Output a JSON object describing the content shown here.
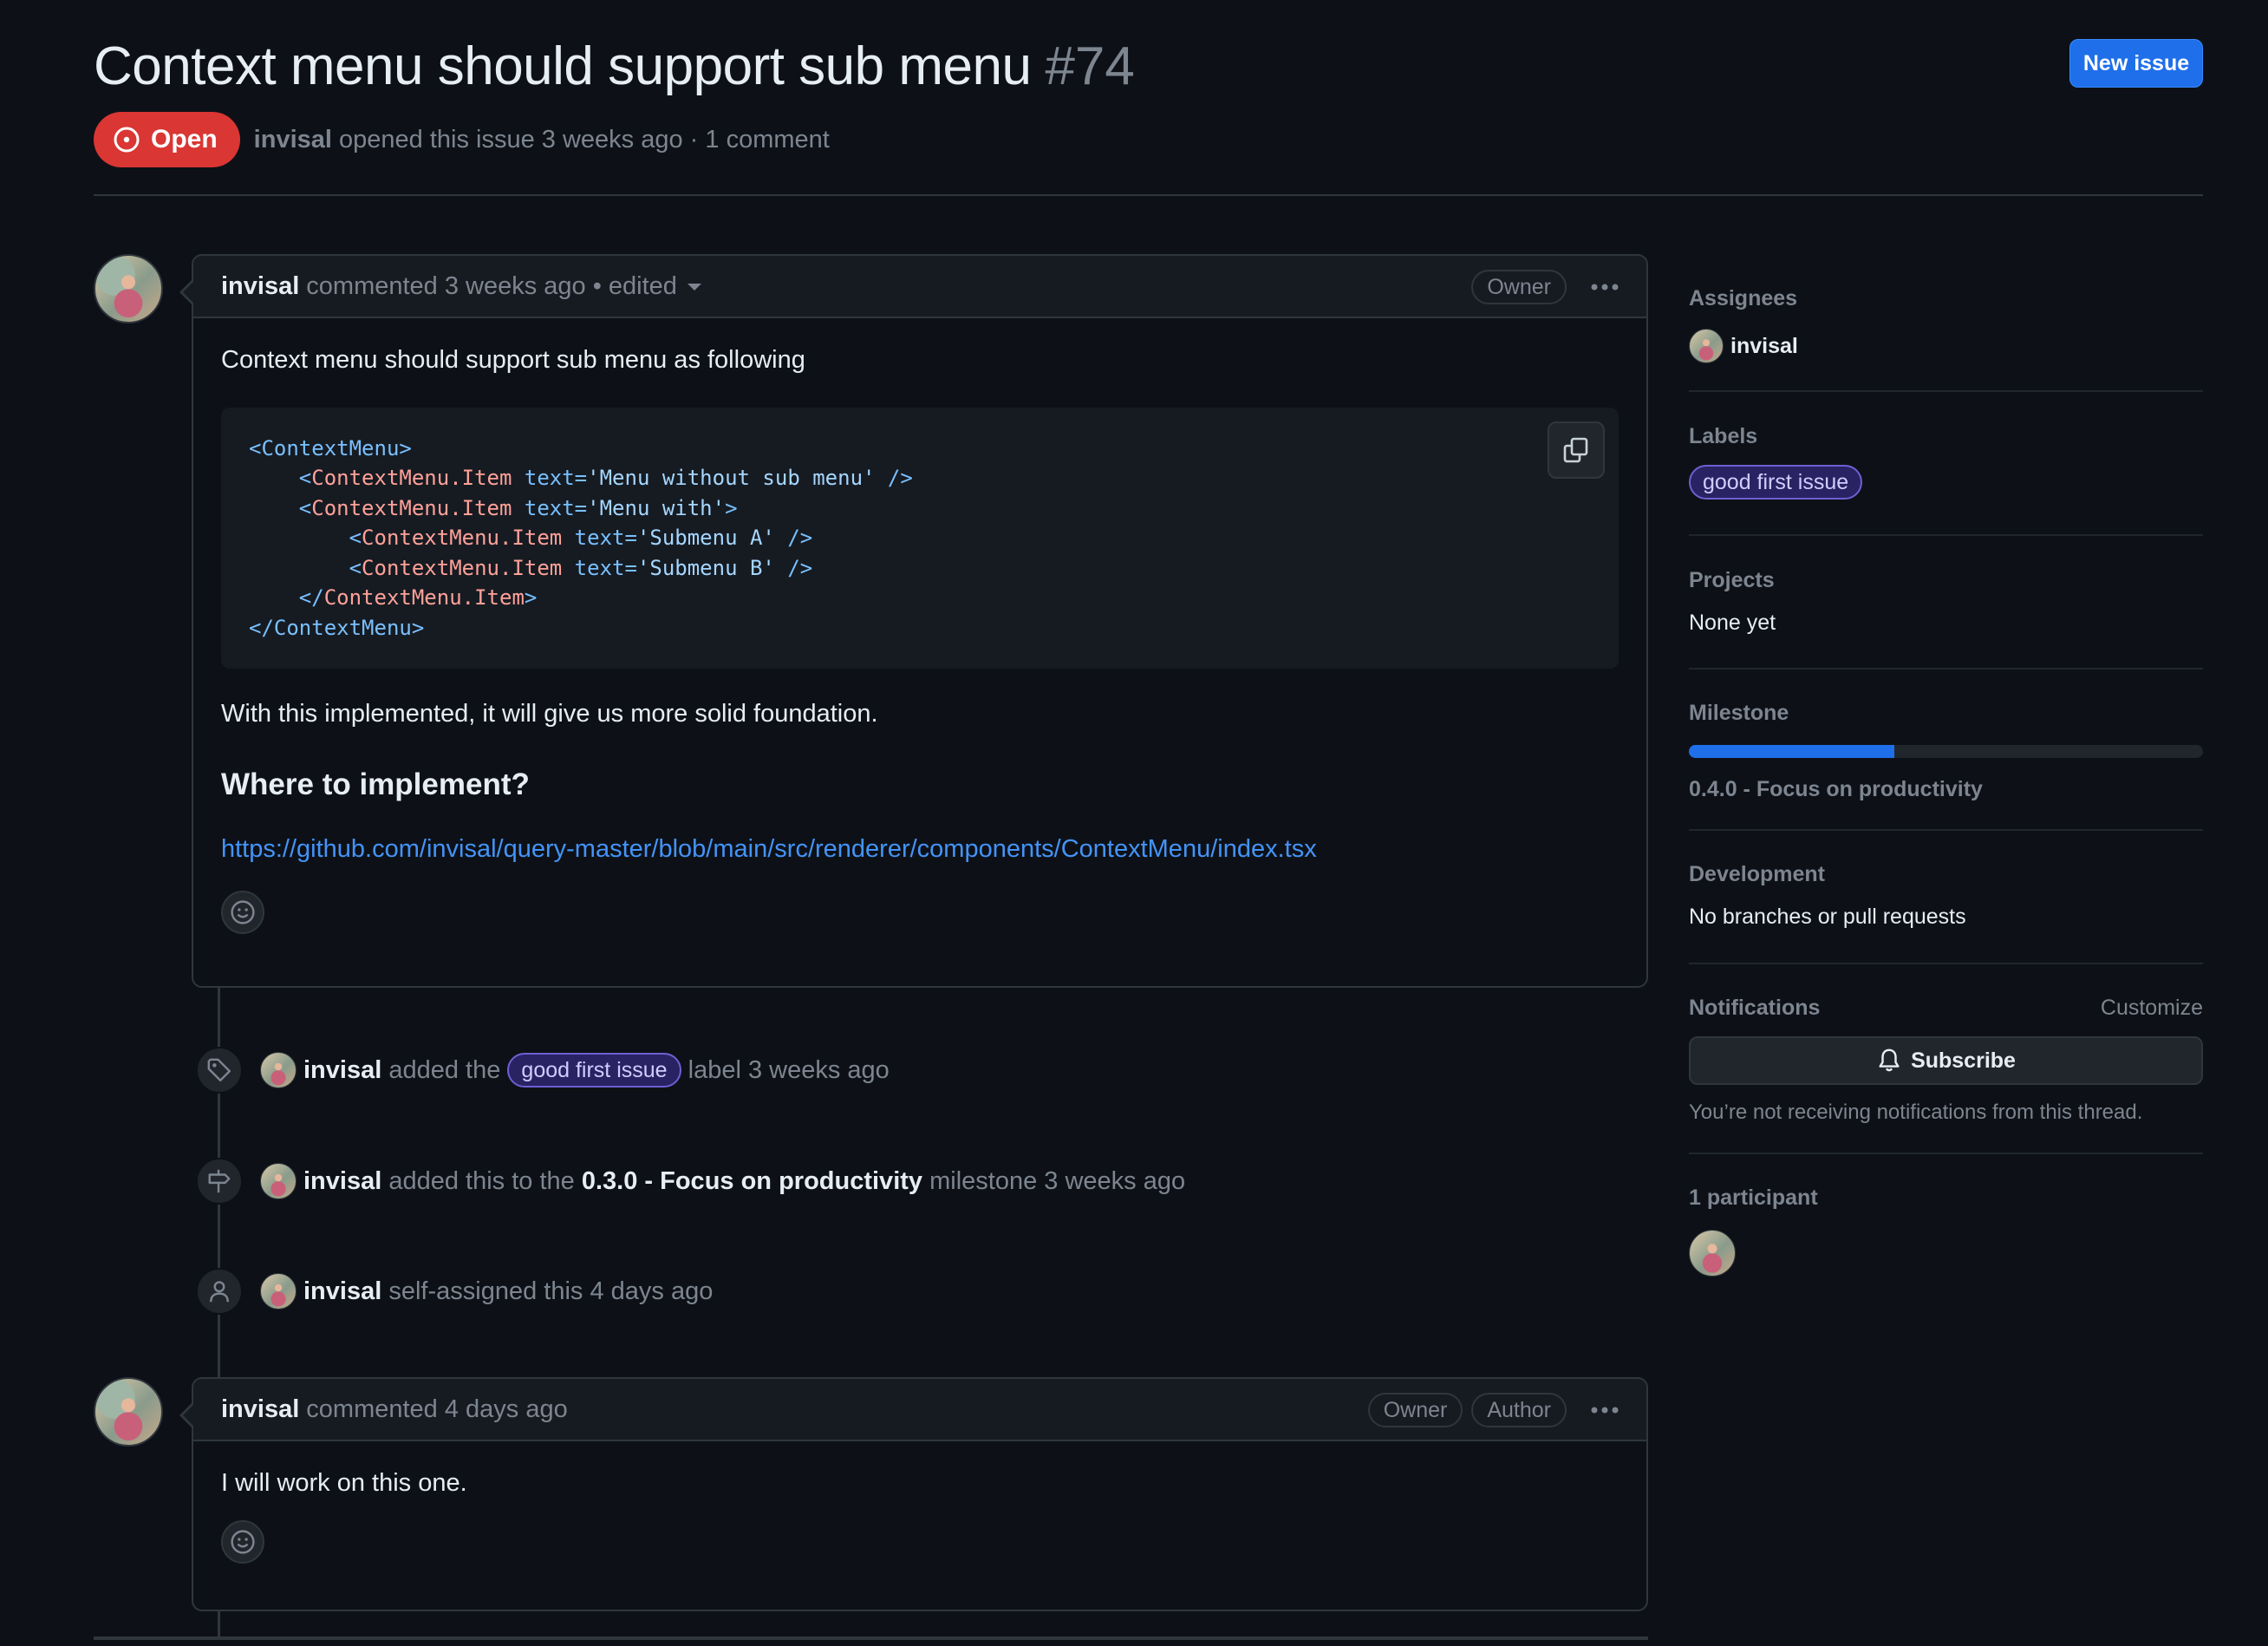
{
  "issue": {
    "title": "Context menu should support sub menu",
    "number": "#74",
    "state": "Open",
    "author": "invisal",
    "meta": "opened this issue 3 weeks ago · 1 comment",
    "new_issue_label": "New issue"
  },
  "comments": [
    {
      "author": "invisal",
      "action": "commented 3 weeks ago",
      "edited": "• edited",
      "badges": [
        "Owner"
      ],
      "paragraph1": "Context menu should support sub menu as following",
      "code_lines": [
        [
          "<",
          "ContextMenu",
          ">"
        ],
        [
          "    <",
          "ContextMenu.Item",
          " text=",
          "'Menu without sub menu'",
          " />"
        ],
        [
          "    <",
          "ContextMenu.Item",
          " text=",
          "'Menu with'",
          ">"
        ],
        [
          "        <",
          "ContextMenu.Item",
          " text=",
          "'Submenu A'",
          " />"
        ],
        [
          "        <",
          "ContextMenu.Item",
          " text=",
          "'Submenu B'",
          " />"
        ],
        [
          "    </",
          "ContextMenu.Item",
          ">"
        ],
        [
          "</",
          "ContextMenu",
          ">"
        ]
      ],
      "paragraph2": "With this implemented, it will give us more solid foundation.",
      "heading": "Where to implement?",
      "link": "https://github.com/invisal/query-master/blob/main/src/renderer/components/ContextMenu/index.tsx"
    },
    {
      "author": "invisal",
      "action": "commented 4 days ago",
      "badges": [
        "Owner",
        "Author"
      ],
      "paragraph1": "I will work on this one."
    }
  ],
  "timeline": [
    {
      "icon": "tag-icon",
      "actor": "invisal",
      "pre": "added the",
      "label": "good first issue",
      "post": "label 3 weeks ago"
    },
    {
      "icon": "milestone-icon",
      "actor": "invisal",
      "pre": "added this to the",
      "milestone": "0.3.0 - Focus on productivity",
      "post": "milestone 3 weeks ago"
    },
    {
      "icon": "person-icon",
      "actor": "invisal",
      "pre": "self-assigned this 4 days ago"
    }
  ],
  "sidebar": {
    "assignees": {
      "heading": "Assignees",
      "name": "invisal"
    },
    "labels": {
      "heading": "Labels",
      "label": "good first issue",
      "label_color": "#6e5fd3"
    },
    "projects": {
      "heading": "Projects",
      "value": "None yet"
    },
    "milestone": {
      "heading": "Milestone",
      "progress": 0.4,
      "name": "0.4.0 - Focus on productivity"
    },
    "development": {
      "heading": "Development",
      "value": "No branches or pull requests"
    },
    "notifications": {
      "heading": "Notifications",
      "customize": "Customize",
      "subscribe": "Subscribe",
      "note": "You’re not receiving notifications from this thread."
    },
    "participants": {
      "heading": "1 participant"
    }
  },
  "colors": {
    "accent": "#1f6feb",
    "open": "#da3633",
    "link": "#4493f8",
    "background": "#0d1117"
  }
}
